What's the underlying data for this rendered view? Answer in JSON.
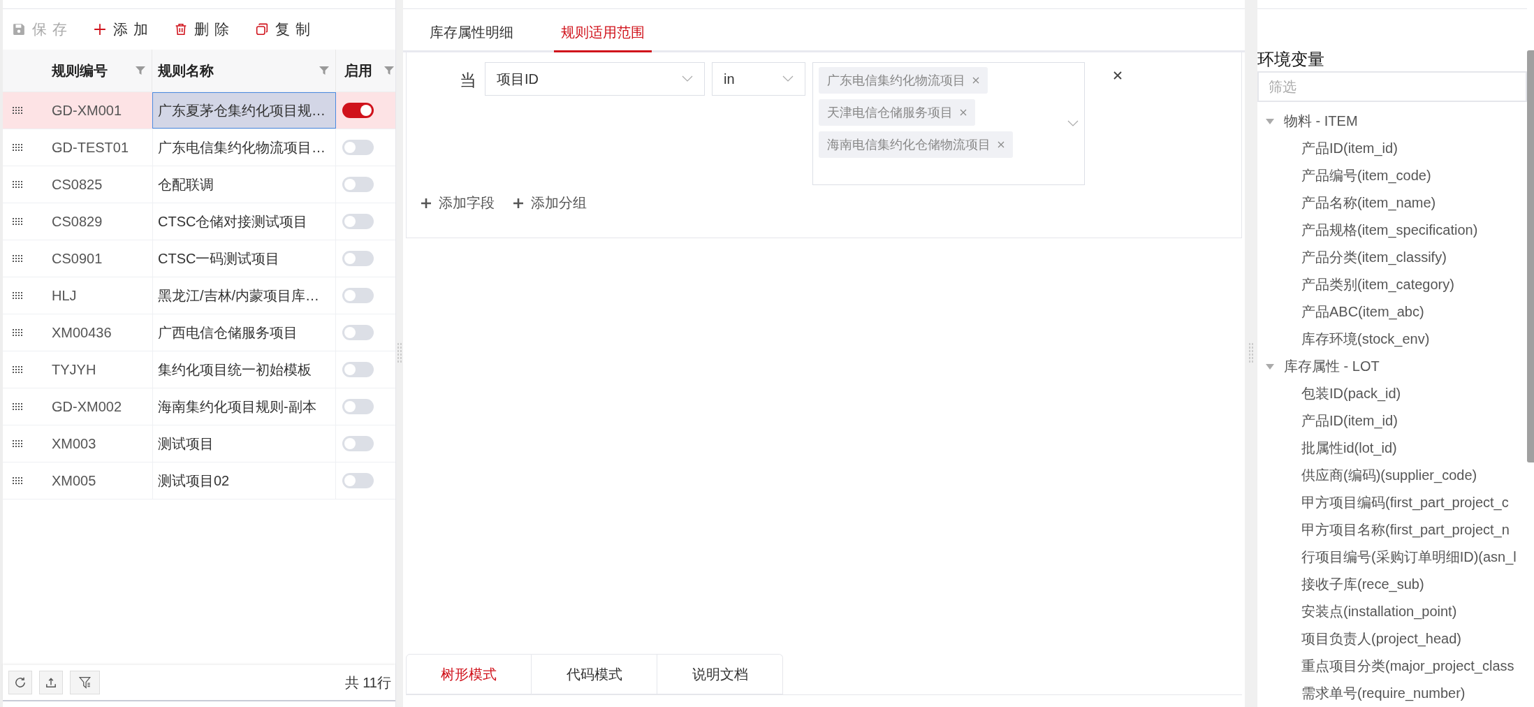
{
  "toolbar": [
    {
      "kind": "save",
      "label": "保存",
      "disabled": true
    },
    {
      "kind": "add",
      "label": "添加",
      "disabled": false
    },
    {
      "kind": "delete",
      "label": "删除",
      "disabled": false
    },
    {
      "kind": "copy",
      "label": "复制",
      "disabled": false
    }
  ],
  "table": {
    "columns": [
      "规则编号",
      "规则名称",
      "启用"
    ],
    "rows": [
      {
        "code": "GD-XM001",
        "name": "广东夏茅仓集约化项目规…",
        "enabled": true,
        "selected": true
      },
      {
        "code": "GD-TEST01",
        "name": "广东电信集约化物流项目…",
        "enabled": false,
        "selected": false
      },
      {
        "code": "CS0825",
        "name": "仓配联调",
        "enabled": false,
        "selected": false
      },
      {
        "code": "CS0829",
        "name": "CTSC仓储对接测试项目",
        "enabled": false,
        "selected": false
      },
      {
        "code": "CS0901",
        "name": "CTSC一码测试项目",
        "enabled": false,
        "selected": false
      },
      {
        "code": "HLJ",
        "name": "黑龙江/吉林/内蒙项目库…",
        "enabled": false,
        "selected": false
      },
      {
        "code": "XM00436",
        "name": "广西电信仓储服务项目",
        "enabled": false,
        "selected": false
      },
      {
        "code": "TYJYH",
        "name": "集约化项目统一初始模板",
        "enabled": false,
        "selected": false
      },
      {
        "code": "GD-XM002",
        "name": "海南集约化项目规则-副本",
        "enabled": false,
        "selected": false
      },
      {
        "code": "XM003",
        "name": "测试项目",
        "enabled": false,
        "selected": false
      },
      {
        "code": "XM005",
        "name": "测试项目02",
        "enabled": false,
        "selected": false
      }
    ]
  },
  "footer": {
    "total": "共 11行"
  },
  "tabs": [
    {
      "label": "库存属性明细",
      "selected": false
    },
    {
      "label": "规则适用范围",
      "selected": true
    }
  ],
  "condition": {
    "prefix": "当",
    "field": "项目ID",
    "operator": "in",
    "values": [
      "广东电信集约化物流项目",
      "天津电信仓储服务项目",
      "海南电信集约化仓储物流项目"
    ]
  },
  "actions": [
    "添加字段",
    "添加分组"
  ],
  "mode_tabs": [
    {
      "label": "树形模式",
      "selected": true
    },
    {
      "label": "代码模式",
      "selected": false
    },
    {
      "label": "说明文档",
      "selected": false
    }
  ],
  "env": {
    "title": "环境变量",
    "placeholder": "筛选",
    "groups": [
      {
        "label": "物料 - ITEM",
        "expanded": true,
        "children": [
          {
            "label": "产品ID(item_id)"
          },
          {
            "label": "产品编号(item_code)"
          },
          {
            "label": "产品名称(item_name)"
          },
          {
            "label": "产品规格(item_specification)"
          },
          {
            "label": "产品分类(item_classify)"
          },
          {
            "label": "产品类别(item_category)"
          },
          {
            "label": "产品ABC(item_abc)"
          },
          {
            "label": "库存环境(stock_env)"
          }
        ]
      },
      {
        "label": "库存属性 - LOT",
        "expanded": true,
        "children": [
          {
            "label": "包装ID(pack_id)"
          },
          {
            "label": "产品ID(item_id)"
          },
          {
            "label": "批属性id(lot_id)"
          },
          {
            "label": "供应商(编码)(supplier_code)"
          },
          {
            "label": "甲方项目编码(first_part_project_c"
          },
          {
            "label": "甲方项目名称(first_part_project_n"
          },
          {
            "label": "行项目编号(采购订单明细ID)(asn_l"
          },
          {
            "label": "接收子库(rece_sub)"
          },
          {
            "label": "安装点(installation_point)"
          },
          {
            "label": "项目负责人(project_head)"
          },
          {
            "label": "重点项目分类(major_project_class"
          },
          {
            "label": "需求单号(require_number)"
          }
        ]
      }
    ]
  }
}
